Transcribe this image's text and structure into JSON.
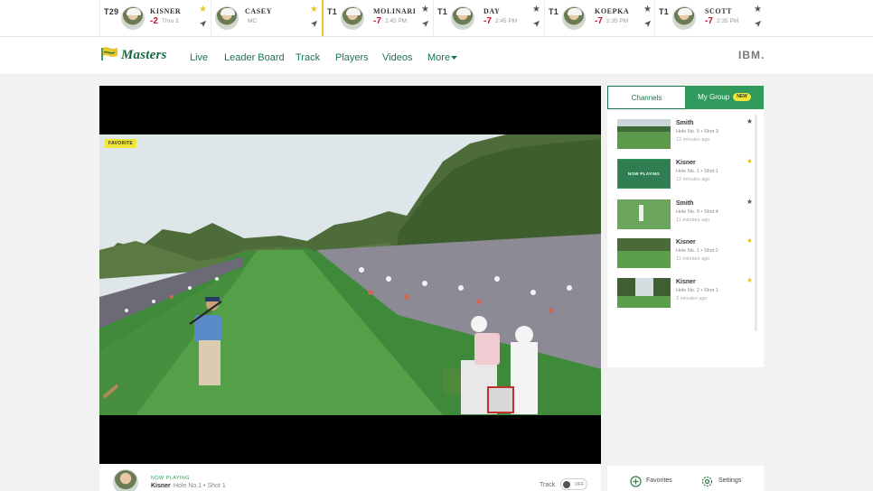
{
  "ticker": [
    {
      "pos": "T29",
      "name": "KISNER",
      "score": "-2",
      "sub": "Thru 2",
      "fav": true,
      "active": false
    },
    {
      "pos": "",
      "name": "CASEY",
      "score": "",
      "sub": "MC",
      "fav": true,
      "active": false
    },
    {
      "pos": "T1",
      "name": "MOLINARI",
      "score": "-7",
      "sub": "2:45 PM",
      "fav": false,
      "active": true
    },
    {
      "pos": "T1",
      "name": "DAY",
      "score": "-7",
      "sub": "2:45 PM",
      "fav": false,
      "active": false
    },
    {
      "pos": "T1",
      "name": "KOEPKA",
      "score": "-7",
      "sub": "2:35 PM",
      "fav": false,
      "active": false
    },
    {
      "pos": "T1",
      "name": "SCOTT",
      "score": "-7",
      "sub": "2:35 PM",
      "fav": false,
      "active": false
    }
  ],
  "header": {
    "logo_text": "Masters",
    "nav": [
      "Live",
      "Leader Board",
      "Track",
      "Players",
      "Videos",
      "More"
    ],
    "partner": "IBM."
  },
  "video": {
    "badge": "FAVORITE"
  },
  "now_playing": {
    "label": "NOW PLAYING",
    "name": "Kisner",
    "shot": "Hole No.1 • Shot 1",
    "track_label": "Track",
    "toggle_state": "OFF"
  },
  "sidebar": {
    "tabs": [
      "Channels",
      "My Group"
    ],
    "new_badge": "NEW",
    "items": [
      {
        "name": "Smith",
        "shot": "Hole No. 9 • Shot 3",
        "ago": "12 minutes ago",
        "fav": false,
        "playing": false
      },
      {
        "name": "Kisner",
        "shot": "Hole No. 1 • Shot 1",
        "ago": "12 minutes ago",
        "fav": true,
        "playing": true,
        "thumb_label": "NOW PLAYING"
      },
      {
        "name": "Smith",
        "shot": "Hole No. 9 • Shot 4",
        "ago": "11 minutes ago",
        "fav": false,
        "playing": false
      },
      {
        "name": "Kisner",
        "shot": "Hole No. 1 • Shot 2",
        "ago": "11 minutes ago",
        "fav": true,
        "playing": false
      },
      {
        "name": "Kisner",
        "shot": "Hole No. 2 • Shot 1",
        "ago": "3 minutes ago",
        "fav": true,
        "playing": false
      }
    ],
    "footer": {
      "favorites": "Favorites",
      "settings": "Settings"
    }
  },
  "colors": {
    "brand_green": "#16784a",
    "accent_yellow": "#e8c52a",
    "score_red": "#c8102e"
  }
}
